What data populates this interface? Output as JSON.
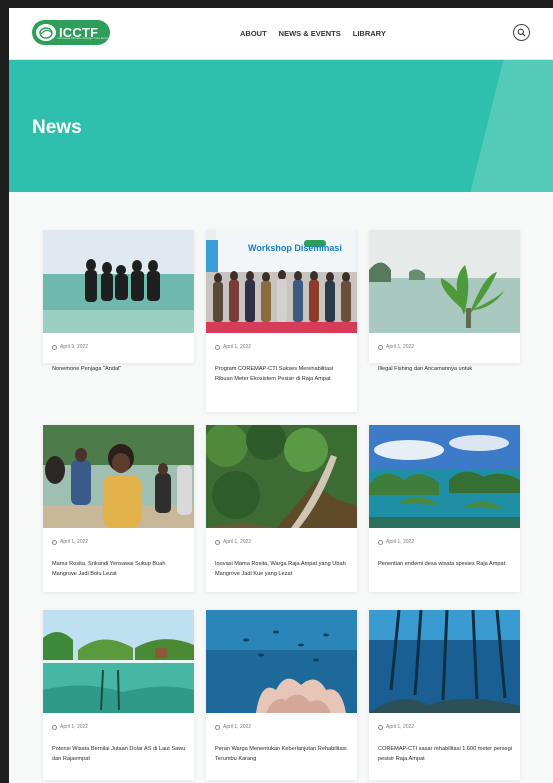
{
  "header": {
    "logo_text": "ICCTF",
    "logo_subtitle": "Indonesia Climate Change Trust Fund",
    "nav": [
      "ABOUT",
      "NEWS & EVENTS",
      "LIBRARY"
    ]
  },
  "hero": {
    "title": "News"
  },
  "colors": {
    "teal": "#2ec0ad",
    "brand_green": "#2e9e5a"
  },
  "cards": [
    {
      "date": "April 9, 2022",
      "title": "Nonemone Penjaga \"Andal\"",
      "image": "women-in-sea"
    },
    {
      "date": "April 1, 2022",
      "title": "Program COREMAP-CTI Sukses Merehabilitasi Ribuan Meter Ekosistem Pesisir di Raja Ampat",
      "image": "workshop-group-photo",
      "image_text": "Workshop Diseminasi"
    },
    {
      "date": "April 1, 2022",
      "title": "Illegal Fishing dan Ancamannya untuk",
      "image": "mangrove-seedling"
    },
    {
      "date": "April 1, 2022",
      "title": "Mama Rosita, Srikandi Yensawai Sukup Buah Mangrove Jadi Bolu Lezat",
      "image": "woman-smiling"
    },
    {
      "date": "April 1, 2022",
      "title": "Inovasi Mama Rosita, Warga Raja Ampat yang Ubah Mangrove Jadi Kue yang Lezat",
      "image": "mangrove-boardwalk"
    },
    {
      "date": "April 1, 2022",
      "title": "Penentian endemi desa wisata spesies Raja Ampat",
      "image": "karst-islands"
    },
    {
      "date": "April 1, 2022",
      "title": "Potensi Wisata Bernilai Jutaan Dolar AS di Laut Sawu dan Rajaempat",
      "image": "split-underwater-palms"
    },
    {
      "date": "April 1, 2022",
      "title": "Peran Warga Menentukan Keberlanjutan Rehabilitasi Terumbu Karang",
      "image": "coral-reef-fish"
    },
    {
      "date": "April 1, 2022",
      "title": "COREMAP-CTI sasar rehabilitasi 1.600 meter persegi pesisir Raja Ampat",
      "image": "underwater-pier"
    }
  ]
}
